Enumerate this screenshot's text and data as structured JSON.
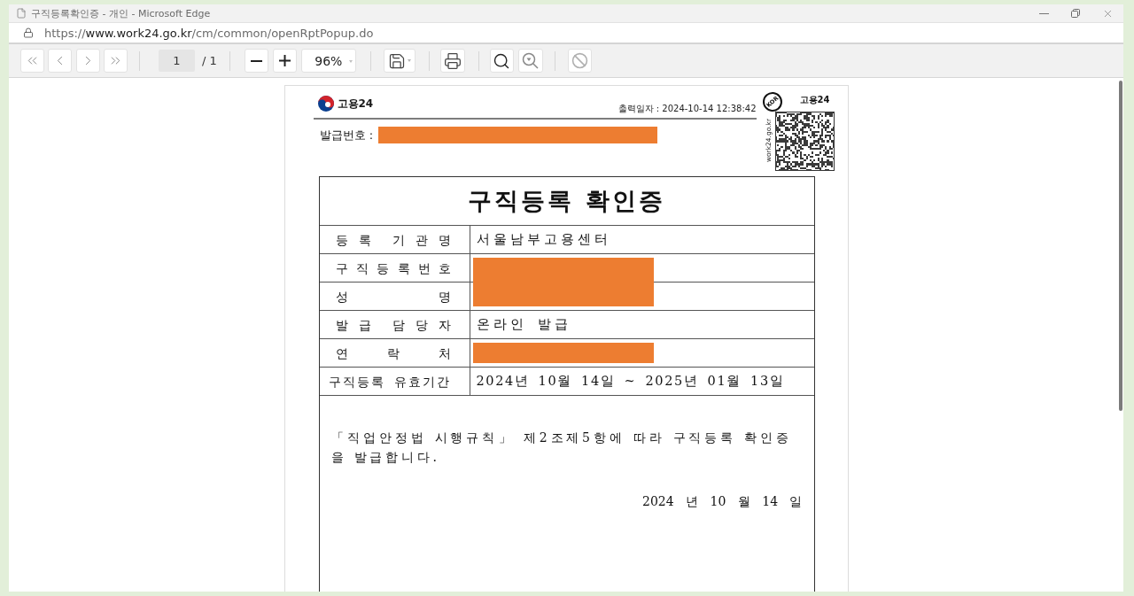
{
  "window": {
    "title": "구직등록확인증 - 개인 - Microsoft Edge"
  },
  "address_bar": {
    "scheme": "https://",
    "host": "www.work24.go.kr",
    "path": "/cm/common/openRptPopup.do"
  },
  "toolbar": {
    "page_number": "1",
    "page_count": "/ 1",
    "zoom": "96%",
    "block_button": {
      "disabled": true
    }
  },
  "document": {
    "logo_text": "고용24",
    "printed_at": "출력일자 : 2024-10-14 12:38:42",
    "issue_number": {
      "label": "발급번호 :",
      "redacted": true
    },
    "stamp_text": "KOR",
    "qr_caption": "고용24",
    "vertical_url": "work24.go.kr",
    "title": "구직등록 확인증",
    "rows": [
      {
        "label": "등 록  기 관 명",
        "value": "서울남부고용센터",
        "redacted": false
      },
      {
        "label": "구 직 등 록 번 호",
        "redacted": true
      },
      {
        "label": "성 명",
        "redacted": true
      },
      {
        "label": "발 급  담 당 자",
        "value": "온라인 발급",
        "redacted": false
      },
      {
        "label": "연 락 처",
        "redacted": true
      },
      {
        "label": "구직등록 유효기간",
        "value": "2024년 10월 14일 ~ 2025년 01월 13일",
        "redacted": false
      }
    ],
    "statement": "「직업안정법 시행규칙」 제2조제5항에 따라 구직등록 확인증을 발급합니다.",
    "date": "2024 년 10 월 14 일"
  }
}
